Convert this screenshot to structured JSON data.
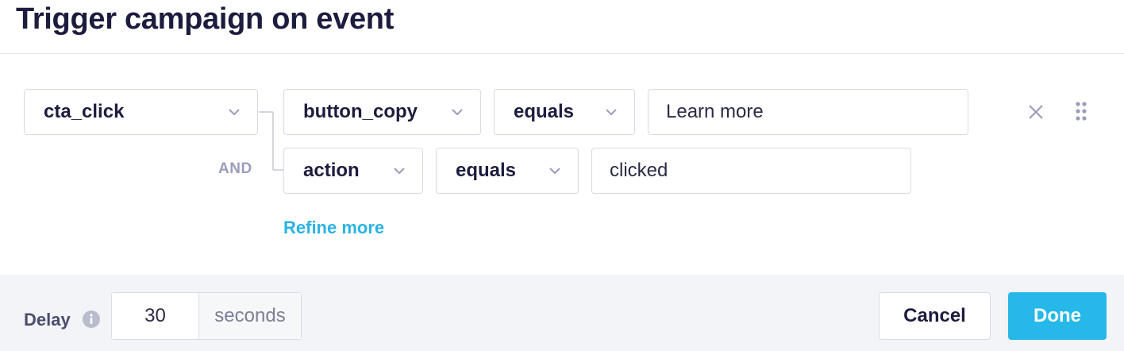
{
  "dialog": {
    "title": "Trigger campaign on event"
  },
  "event_select": {
    "value": "cta_click"
  },
  "conditions": {
    "joiner": "AND",
    "rows": [
      {
        "property": "button_copy",
        "operator": "equals",
        "value": "Learn more"
      },
      {
        "property": "action",
        "operator": "equals",
        "value": "clicked"
      }
    ]
  },
  "refine_link": "Refine more",
  "row_icons": {
    "remove": "close-icon",
    "reorder": "drag-handle-icon"
  },
  "footer": {
    "delay_label": "Delay",
    "delay_value": "30",
    "delay_unit": "seconds",
    "info_icon": "info-icon",
    "cancel_label": "Cancel",
    "done_label": "Done"
  },
  "colors": {
    "accent": "#26b8e8",
    "link": "#2bb3e4",
    "title": "#1c1d3e",
    "footer_bg": "#f3f4f7"
  }
}
